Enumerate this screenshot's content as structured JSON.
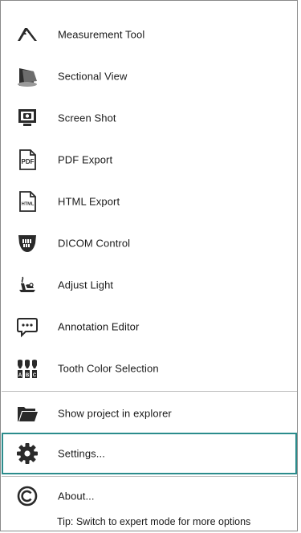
{
  "menu": {
    "items": [
      {
        "label": "Measurement Tool",
        "icon": "caliper-icon"
      },
      {
        "label": "Sectional View",
        "icon": "sectional-view-icon"
      },
      {
        "label": "Screen Shot",
        "icon": "camera-screen-icon"
      },
      {
        "label": "PDF Export",
        "icon": "pdf-file-icon"
      },
      {
        "label": "HTML Export",
        "icon": "html-file-icon"
      },
      {
        "label": "DICOM Control",
        "icon": "dicom-jaw-icon"
      },
      {
        "label": "Adjust Light",
        "icon": "lamp-icon"
      },
      {
        "label": "Annotation Editor",
        "icon": "speech-bubble-icon"
      },
      {
        "label": "Tooth Color Selection",
        "icon": "tooth-shade-icon"
      },
      {
        "label": "Show project in explorer",
        "icon": "folder-icon"
      },
      {
        "label": "Settings...",
        "icon": "gear-icon"
      },
      {
        "label": "About...",
        "icon": "copyright-icon"
      }
    ],
    "tip": "Tip: Switch to expert mode for more options",
    "accent_color": "#2b8c8c"
  },
  "pdf_icon_text": "PDF",
  "html_icon_text": "HTML",
  "shade_letters": [
    "A",
    "B",
    "C"
  ]
}
